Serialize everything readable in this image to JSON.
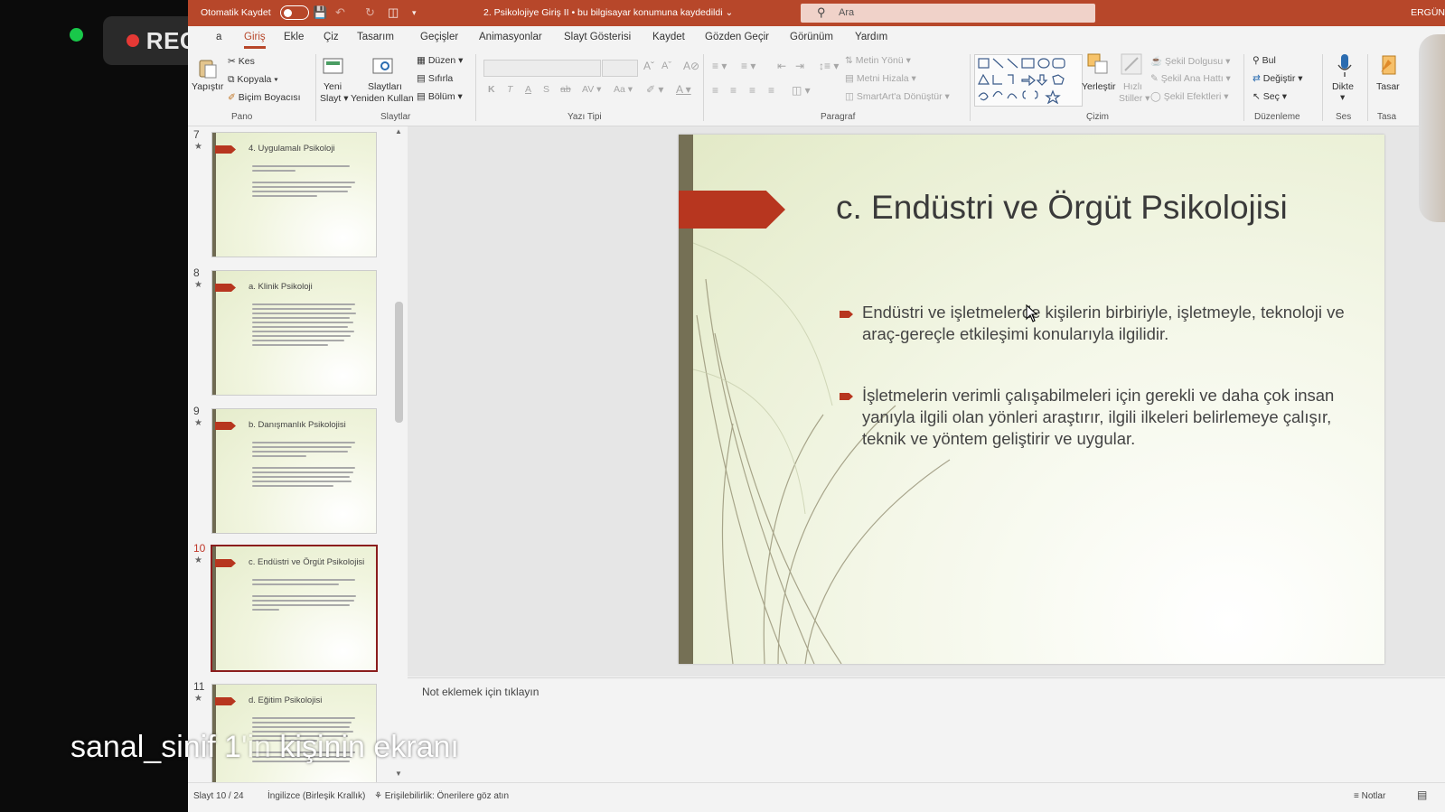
{
  "overlay": {
    "rec_label": "REC",
    "caption_visible": "sanal_sinif 1",
    "caption_hidden": "'in kişinin ekranı",
    "caption_rest": "kişinin ekranı"
  },
  "titlebar": {
    "autosave_label": "Otomatik Kaydet",
    "doc_title": "2. Psikolojiye Giriş II  •  bu bilgisayar konumuna kaydedildi",
    "search_placeholder": "Ara",
    "user": "ERGÜN"
  },
  "tabs": [
    "a",
    "Giriş",
    "Ekle",
    "Çiz",
    "Tasarım",
    "Geçişler",
    "Animasyonlar",
    "Slayt Gösterisi",
    "Kaydet",
    "Gözden Geçir",
    "Görünüm",
    "Yardım"
  ],
  "ribbon": {
    "pano": {
      "paste": "Yapıştır",
      "cut": "Kes",
      "copy": "Kopyala",
      "format_painter": "Biçim Boyacısı",
      "label": "Pano"
    },
    "slides": {
      "new_slide_1": "Yeni",
      "new_slide_2": "Slayt",
      "reuse_1": "Slaytları",
      "reuse_2": "Yeniden Kullan",
      "layout": "Düzen",
      "reset": "Sıfırla",
      "section": "Bölüm",
      "label": "Slaytlar"
    },
    "font": {
      "label": "Yazı Tipi",
      "bold": "K",
      "italic": "T",
      "underline": "A",
      "shadow": "S",
      "strike": "ab",
      "spacing": "AV",
      "case": "Aa"
    },
    "paragraph": {
      "label": "Paragraf",
      "text_dir": "Metin Yönü",
      "align_text": "Metni Hizala",
      "smartart": "SmartArt'a Dönüştür"
    },
    "drawing": {
      "label": "Çizim",
      "arrange": "Yerleştir",
      "quick_1": "Hızlı",
      "quick_2": "Stiller",
      "fill": "Şekil Dolgusu",
      "outline": "Şekil Ana Hattı",
      "effects": "Şekil Efektleri"
    },
    "editing": {
      "label": "Düzenleme",
      "find": "Bul",
      "replace": "Değiştir",
      "select": "Seç"
    },
    "voice": {
      "label": "Ses",
      "dictate": "Dikte"
    },
    "designer": {
      "label": "Tasa",
      "btn": "Tasar"
    }
  },
  "thumbnails": [
    {
      "num": "7",
      "title": "4. Uygulamalı Psikoloji",
      "lines": [
        2,
        4
      ]
    },
    {
      "num": "8",
      "title": "a. Klinik Psikoloji",
      "lines": [
        10
      ]
    },
    {
      "num": "9",
      "title": "b. Danışmanlık Psikolojisi",
      "lines": [
        4,
        5
      ]
    },
    {
      "num": "10",
      "title": "c. Endüstri ve Örgüt Psikolojisi",
      "lines": [
        2,
        4
      ]
    },
    {
      "num": "11",
      "title": "d. Eğitim Psikolojisi",
      "lines": [
        6,
        4
      ]
    }
  ],
  "current_slide": {
    "title": "c. Endüstri ve Örgüt Psikolojisi",
    "bullets": [
      "Endüstri ve işletmelerde kişilerin birbiriyle, işletmeyle, teknoloji ve araç-gereçle etkileşimi konularıyla ilgilidir.",
      "İşletmelerin verimli çalışabilmeleri için gerekli ve daha çok insan yanıyla ilgili olan yönleri araştırır, ilgili ilkeleri belirlemeye çalışır, teknik ve yöntem geliştirir ve uygular."
    ]
  },
  "notes_placeholder": "Not eklemek için tıklayın",
  "status": {
    "slide_pos": "Slayt 10 / 24",
    "language": "İngilizce (Birleşik Krallık)",
    "accessibility": "Erişilebilirlik: Önerilere göz atın",
    "notes": "Notlar"
  },
  "colors": {
    "accent": "#b7472a",
    "slide_arrow": "#b7361f",
    "slide_bar": "#757055"
  }
}
